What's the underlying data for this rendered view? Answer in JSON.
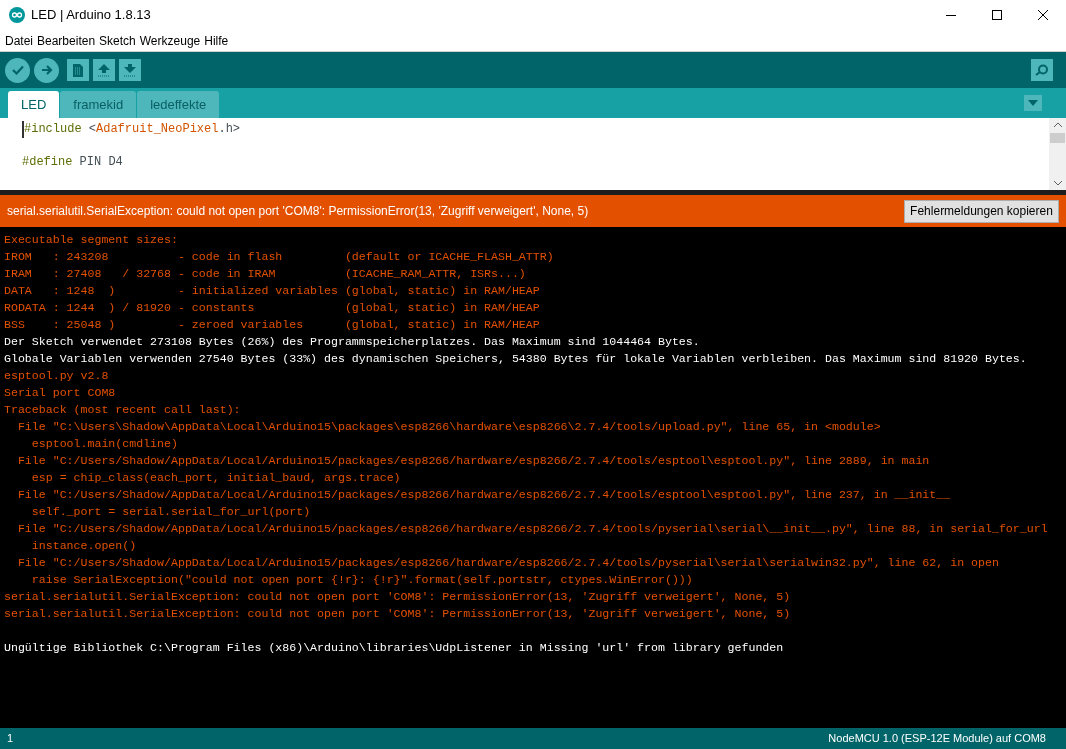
{
  "window": {
    "title": "LED | Arduino 1.8.13"
  },
  "menu": [
    "Datei",
    "Bearbeiten",
    "Sketch",
    "Werkzeuge",
    "Hilfe"
  ],
  "tabs": [
    {
      "label": "LED",
      "selected": true
    },
    {
      "label": "framekid",
      "selected": false
    },
    {
      "label": "ledeffekte",
      "selected": false
    }
  ],
  "editor": {
    "lines": [
      {
        "kind": "code",
        "segments": [
          {
            "text": "#include ",
            "kind": "directive"
          },
          {
            "text": "<",
            "kind": "plain"
          },
          {
            "text": "Adafruit_NeoPixel",
            "kind": "string"
          },
          {
            "text": ".h>",
            "kind": "plain"
          }
        ]
      },
      {
        "kind": "blank"
      },
      {
        "kind": "code",
        "segments": [
          {
            "text": "#define ",
            "kind": "directive"
          },
          {
            "text": "PIN D4",
            "kind": "plain"
          }
        ]
      }
    ]
  },
  "error_bar": {
    "message": "serial.serialutil.SerialException: could not open port 'COM8': PermissionError(13, 'Zugriff verweigert', None, 5)",
    "button": "Fehlermeldungen kopieren"
  },
  "console": [
    {
      "text": "Executable segment sizes:",
      "kind": "error"
    },
    {
      "text": "IROM   : 243208          - code in flash         (default or ICACHE_FLASH_ATTR)",
      "kind": "error"
    },
    {
      "text": "IRAM   : 27408   / 32768 - code in IRAM          (ICACHE_RAM_ATTR, ISRs...)",
      "kind": "error"
    },
    {
      "text": "DATA   : 1248  )         - initialized variables (global, static) in RAM/HEAP",
      "kind": "error"
    },
    {
      "text": "RODATA : 1244  ) / 81920 - constants             (global, static) in RAM/HEAP",
      "kind": "error"
    },
    {
      "text": "BSS    : 25048 )         - zeroed variables      (global, static) in RAM/HEAP",
      "kind": "error"
    },
    {
      "text": "Der Sketch verwendet 273108 Bytes (26%) des Programmspeicherplatzes. Das Maximum sind 1044464 Bytes.",
      "kind": "info"
    },
    {
      "text": "Globale Variablen verwenden 27540 Bytes (33%) des dynamischen Speichers, 54380 Bytes für lokale Variablen verbleiben. Das Maximum sind 81920 Bytes.",
      "kind": "info"
    },
    {
      "text": "esptool.py v2.8",
      "kind": "error"
    },
    {
      "text": "Serial port COM8",
      "kind": "error"
    },
    {
      "text": "Traceback (most recent call last):",
      "kind": "error"
    },
    {
      "text": "  File \"C:\\Users\\Shadow\\AppData\\Local\\Arduino15\\packages\\esp8266\\hardware\\esp8266\\2.7.4/tools/upload.py\", line 65, in <module>",
      "kind": "error"
    },
    {
      "text": "    esptool.main(cmdline)",
      "kind": "error"
    },
    {
      "text": "  File \"C:/Users/Shadow/AppData/Local/Arduino15/packages/esp8266/hardware/esp8266/2.7.4/tools/esptool\\esptool.py\", line 2889, in main",
      "kind": "error"
    },
    {
      "text": "    esp = chip_class(each_port, initial_baud, args.trace)",
      "kind": "error"
    },
    {
      "text": "  File \"C:/Users/Shadow/AppData/Local/Arduino15/packages/esp8266/hardware/esp8266/2.7.4/tools/esptool\\esptool.py\", line 237, in __init__",
      "kind": "error"
    },
    {
      "text": "    self._port = serial.serial_for_url(port)",
      "kind": "error"
    },
    {
      "text": "  File \"C:/Users/Shadow/AppData/Local/Arduino15/packages/esp8266/hardware/esp8266/2.7.4/tools/pyserial\\serial\\__init__.py\", line 88, in serial_for_url",
      "kind": "error"
    },
    {
      "text": "    instance.open()",
      "kind": "error"
    },
    {
      "text": "  File \"C:/Users/Shadow/AppData/Local/Arduino15/packages/esp8266/hardware/esp8266/2.7.4/tools/pyserial\\serial\\serialwin32.py\", line 62, in open",
      "kind": "error"
    },
    {
      "text": "    raise SerialException(\"could not open port {!r}: {!r}\".format(self.portstr, ctypes.WinError()))",
      "kind": "error"
    },
    {
      "text": "serial.serialutil.SerialException: could not open port 'COM8': PermissionError(13, 'Zugriff verweigert', None, 5)",
      "kind": "error"
    },
    {
      "text": "serial.serialutil.SerialException: could not open port 'COM8': PermissionError(13, 'Zugriff verweigert', None, 5)",
      "kind": "error"
    },
    {
      "kind": "blank"
    },
    {
      "text": "Ungültige Bibliothek C:\\Program Files (x86)\\Arduino\\libraries\\UdpListener in Missing 'url' from library gefunden",
      "kind": "info"
    }
  ],
  "status_bar": {
    "line": "1",
    "board": "NodeMCU 1.0 (ESP-12E Module) auf COM8"
  }
}
